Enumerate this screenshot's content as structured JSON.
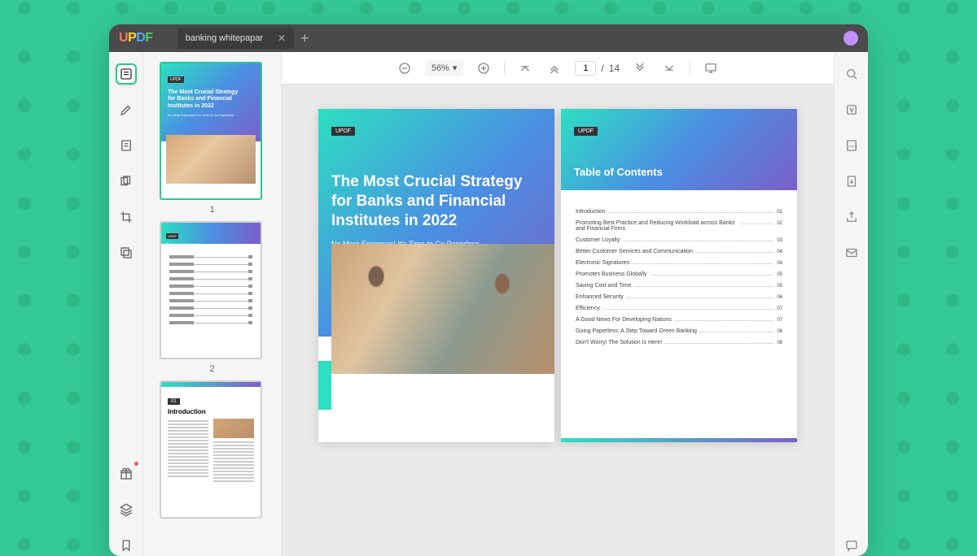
{
  "app": {
    "logo": "UPDF",
    "tab_title": "banking whitepapar"
  },
  "toolbar": {
    "zoom": "56%",
    "current_page": "1",
    "page_sep": "/",
    "total_pages": "14"
  },
  "thumbs": {
    "p1": "1",
    "p2": "2"
  },
  "page1": {
    "brand": "UPDF",
    "title_l1": "The Most Crucial Strategy",
    "title_l2": "for Banks and Financial",
    "title_l3": "Institutes in 2022",
    "sub": "No More Expenses! It's Time to Go Paperless",
    "thumb_sub": "No More Expenses! It's Time to Go Paperless"
  },
  "page2": {
    "brand": "UPDF",
    "heading": "Table of Contents",
    "toc": [
      {
        "t": "Introduction",
        "n": "01"
      },
      {
        "t": "Promoting Best Practice and Reducing Workload across Banks and Financial Firms",
        "n": "02"
      },
      {
        "t": "Customer Loyalty",
        "n": "03"
      },
      {
        "t": "Better Customer Services and Communication",
        "n": "04"
      },
      {
        "t": "Electronic Signatures",
        "n": "04"
      },
      {
        "t": "Promotes Business Globally",
        "n": "05"
      },
      {
        "t": "Saving Cost and Time",
        "n": "05"
      },
      {
        "t": "Enhanced Security",
        "n": "06"
      },
      {
        "t": "Efficiency",
        "n": "07"
      },
      {
        "t": "A Good News For Developing Nations",
        "n": "07"
      },
      {
        "t": "Going Paperless: A Step Toward Green Banking",
        "n": "08"
      },
      {
        "t": "Don't Worry! The Solution Is Here!",
        "n": "08"
      }
    ]
  },
  "page3": {
    "badge": "01",
    "title": "Introduction"
  }
}
